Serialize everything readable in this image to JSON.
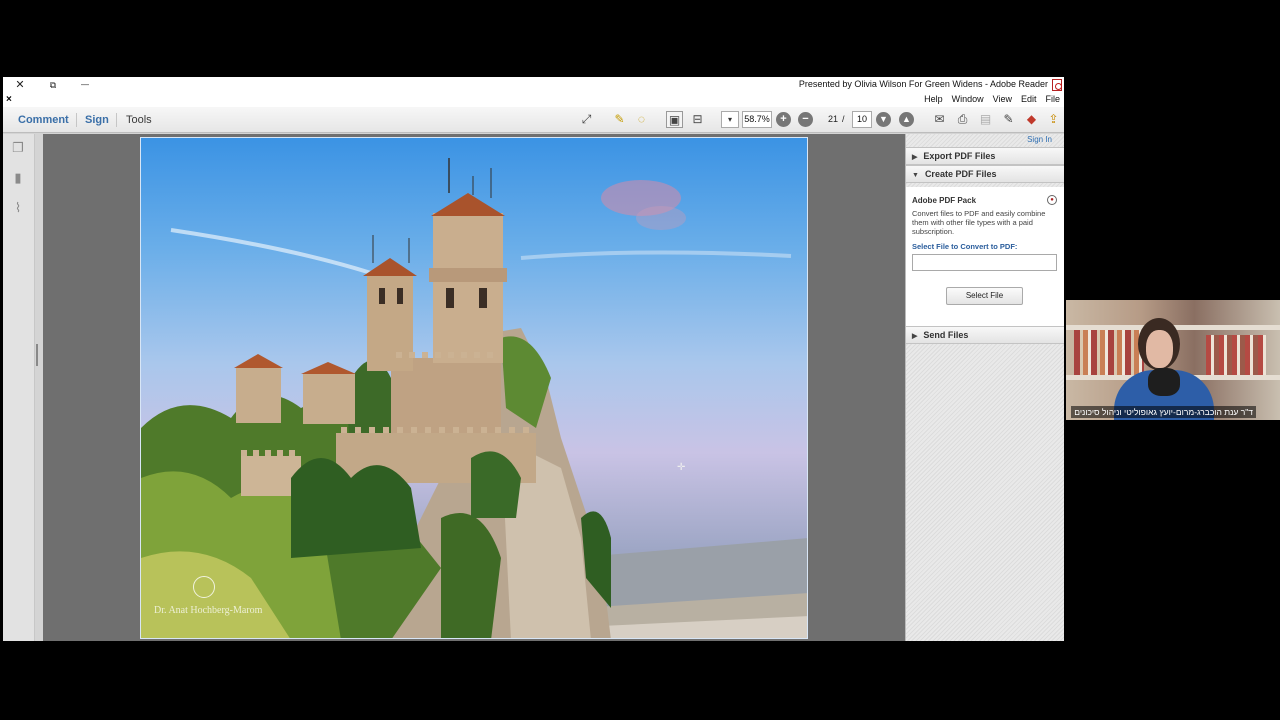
{
  "window": {
    "title": "Presented by Olivia Wilson For Green Widens - Adobe Reader",
    "controls": {
      "close": "✕",
      "restore": "⧉",
      "minimize": "—"
    }
  },
  "menu": {
    "items": [
      "Help",
      "Window",
      "View",
      "Edit",
      "File"
    ],
    "doc_close": "×"
  },
  "toolbar": {
    "comment_label": "Comment",
    "sign_label": "Sign",
    "tools_label": "Tools",
    "zoom_value": "58.7%",
    "current_page": "21",
    "page_separator": "/",
    "total_pages": "10"
  },
  "document": {
    "watermark": "Dr. Anat Hochberg-Marom"
  },
  "right_panel": {
    "sign_in": "Sign In",
    "export_pdf": "Export PDF Files",
    "create_pdf": "Create PDF Files",
    "pdf_pack_title": "Adobe PDF Pack",
    "pdf_pack_desc": "Convert files to PDF and easily combine them with other file types with a paid subscription.",
    "select_label": "Select File to Convert to PDF:",
    "select_button": "Select File",
    "send_files": "Send Files"
  },
  "webcam": {
    "participant_name": "ד\"ר ענת הוכברג-מרום-יועץ גאופוליטי וניהול סיכונים"
  }
}
